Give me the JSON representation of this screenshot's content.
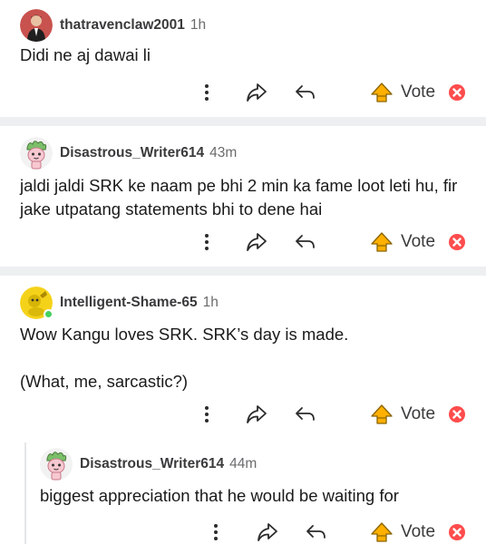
{
  "comments": [
    {
      "username": "thatravenclaw2001",
      "time": "1h",
      "body": "Didi ne aj dawai li",
      "vote_label": "Vote"
    },
    {
      "username": "Disastrous_Writer614",
      "time": "43m",
      "body": "jaldi jaldi SRK ke naam pe bhi 2 min ka fame loot leti hu, fir jake utpatang statements bhi to dene hai",
      "vote_label": "Vote"
    },
    {
      "username": "Intelligent-Shame-65",
      "time": "1h",
      "body": "Wow Kangu loves SRK. SRK’s day is made.\n\n(What, me, sarcastic?)",
      "vote_label": "Vote"
    },
    {
      "username": "Disastrous_Writer614",
      "time": "44m",
      "body": "biggest appreciation that he would be waiting for",
      "vote_label": "Vote"
    }
  ],
  "colors": {
    "separator": "#edeff1",
    "upvote": "#ffb000",
    "close": "#ff4c4c",
    "online": "#46d160"
  },
  "icons": [
    "more-icon",
    "share-icon",
    "reply-icon",
    "upvote-icon",
    "close-icon"
  ]
}
